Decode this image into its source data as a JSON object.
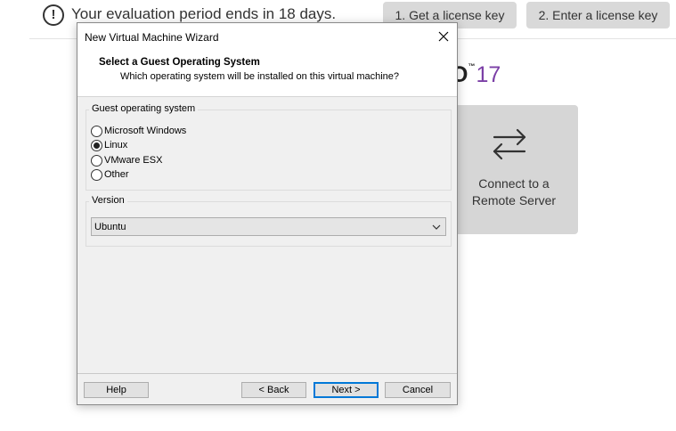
{
  "background": {
    "banner": {
      "message": "Your evaluation period ends in 18 days.",
      "info_icon": "info-circle-icon",
      "buttons": [
        "1. Get a license key",
        "2. Enter a license key"
      ]
    },
    "brand": {
      "partial_letter": "O",
      "trademark": "™",
      "version": "17",
      "version_color": "#7b3fa6"
    },
    "remote_tile": {
      "icon": "swap-arrows-icon",
      "label_line1": "Connect to a",
      "label_line2": "Remote Server"
    }
  },
  "dialog": {
    "title": "New Virtual Machine Wizard",
    "close_icon": "close-icon",
    "header": {
      "title": "Select a Guest Operating System",
      "subtitle": "Which operating system will be installed on this virtual machine?"
    },
    "guest_os": {
      "legend": "Guest operating system",
      "options": [
        {
          "label": "Microsoft Windows",
          "checked": false
        },
        {
          "label": "Linux",
          "checked": true
        },
        {
          "label": "VMware ESX",
          "checked": false
        },
        {
          "label": "Other",
          "checked": false
        }
      ]
    },
    "version": {
      "legend": "Version",
      "selected": "Ubuntu",
      "arrow_icon": "chevron-down-icon"
    },
    "buttons": {
      "help": "Help",
      "back": "< Back",
      "next": "Next >",
      "cancel": "Cancel"
    }
  }
}
